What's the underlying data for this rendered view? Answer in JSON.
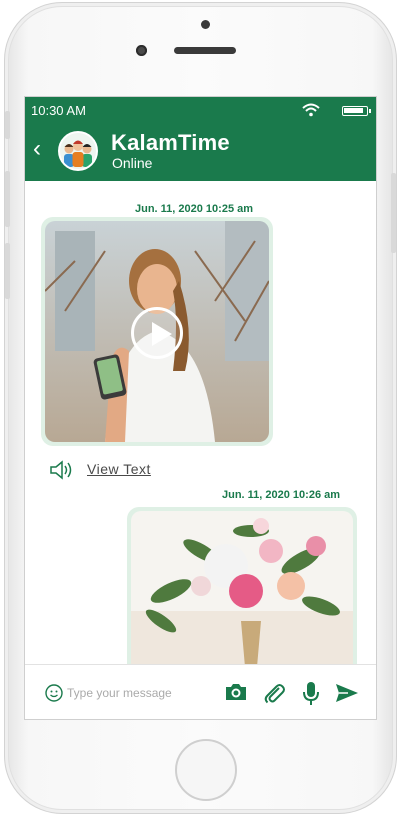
{
  "status_bar": {
    "time": "10:30 AM"
  },
  "header": {
    "name": "KalamTime",
    "status": "Online"
  },
  "messages": [
    {
      "timestamp": "Jun. 11, 2020  10:25 am",
      "kind": "video",
      "action_label": "View Text"
    },
    {
      "timestamp": "Jun. 11, 2020  10:26 am",
      "kind": "image"
    }
  ],
  "composer": {
    "placeholder": "Type your message"
  },
  "colors": {
    "accent": "#1a7a4c",
    "bubble": "#dff0e5"
  },
  "icons": [
    "back-icon",
    "wifi-icon",
    "battery-icon",
    "play-icon",
    "speaker-icon",
    "emoji-icon",
    "camera-icon",
    "paperclip-icon",
    "microphone-icon",
    "send-icon"
  ]
}
